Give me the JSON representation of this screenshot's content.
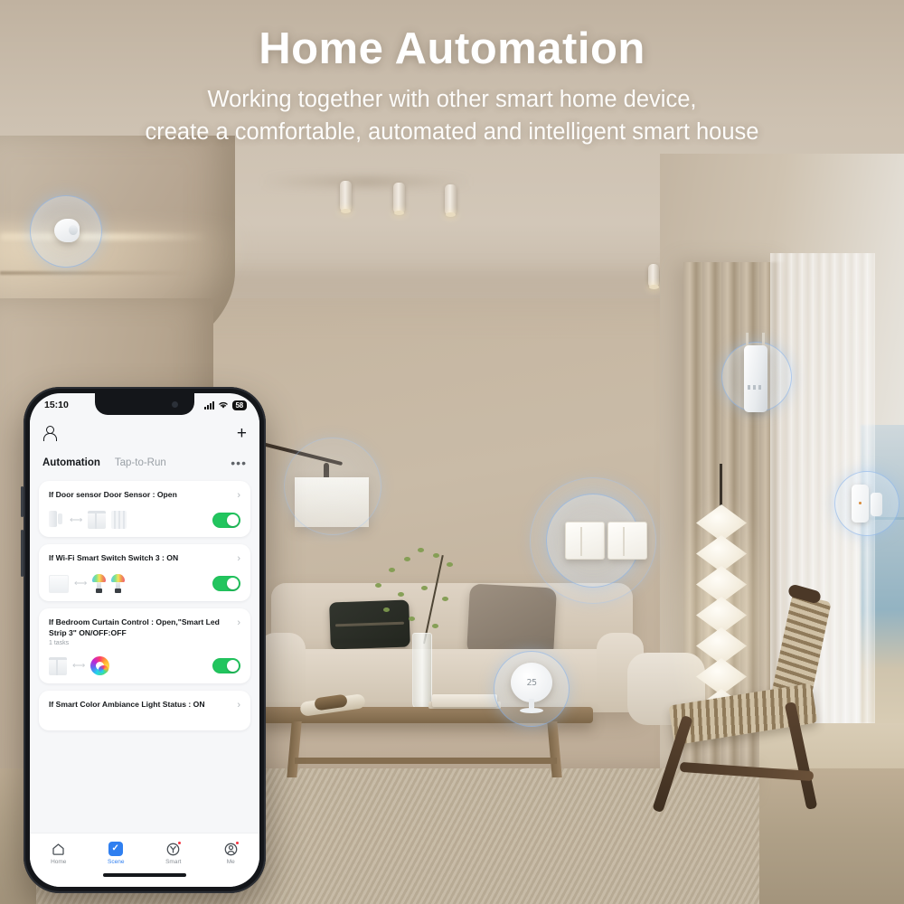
{
  "header": {
    "title": "Home Automation",
    "subtitle_line1": "Working together with other smart home device,",
    "subtitle_line2": "create a comfortable, automated and intelligent smart house"
  },
  "colors": {
    "accent_blue": "#2f7ff0",
    "toggle_green": "#22c55e",
    "halo_blue": "#8ab4eb",
    "badge_red": "#f5333f",
    "wall_beige": "#c4b49f"
  },
  "phone": {
    "status_bar": {
      "time": "15:10",
      "signal_icon": "cellular-signal-icon",
      "wifi_icon": "wifi-icon",
      "battery_level": "58"
    },
    "app_bar": {
      "profile_icon": "person-icon",
      "add_icon": "plus-icon"
    },
    "tabs": [
      {
        "label": "Automation",
        "active": true
      },
      {
        "label": "Tap-to-Run",
        "active": false
      }
    ],
    "overflow_icon": "more-horizontal-icon",
    "automations": [
      {
        "title": "If Door sensor Door Sensor : Open",
        "subtitle": "",
        "chevron": "›",
        "toggle_on": true,
        "devices": [
          "door-sensor-icon",
          "curtain-icon",
          "blind-icon"
        ]
      },
      {
        "title": "If Wi-Fi Smart Switch  Switch 3 : ON",
        "subtitle": "",
        "chevron": "›",
        "toggle_on": true,
        "devices": [
          "smart-switch-icon",
          "color-bulb-icon",
          "color-bulb-icon"
        ]
      },
      {
        "title": "If Bedroom Curtain Control : Open,\"Smart Led Strip 3\" ON/OFF:OFF",
        "subtitle": "1 tasks",
        "chevron": "›",
        "toggle_on": true,
        "devices": [
          "curtain-icon",
          "led-strip-icon"
        ]
      },
      {
        "title": "If Smart Color Ambiance Light  Status : ON",
        "subtitle": "",
        "chevron": "›",
        "toggle_on": true,
        "devices": []
      }
    ],
    "bottom_nav": [
      {
        "label": "Home",
        "icon": "home-icon",
        "active": false,
        "badge": false
      },
      {
        "label": "Scene",
        "icon": "scene-check-icon",
        "active": true,
        "badge": false
      },
      {
        "label": "Smart",
        "icon": "smart-icon",
        "active": false,
        "badge": true
      },
      {
        "label": "Me",
        "icon": "profile-icon",
        "active": false,
        "badge": true
      }
    ]
  },
  "scene_devices": [
    {
      "name": "motion-sensor",
      "label": "Motion Sensor"
    },
    {
      "name": "pendant-lamp",
      "label": "Pendant Lamp"
    },
    {
      "name": "curtain-motor",
      "label": "Curtain Motor"
    },
    {
      "name": "wall-switch-panel",
      "label": "Wall Switch Panel"
    },
    {
      "name": "door-window-sensor",
      "label": "Door / Window Sensor"
    },
    {
      "name": "temperature-humidity-sensor",
      "label": "Temperature Humidity Sensor",
      "reading": "25"
    }
  ]
}
